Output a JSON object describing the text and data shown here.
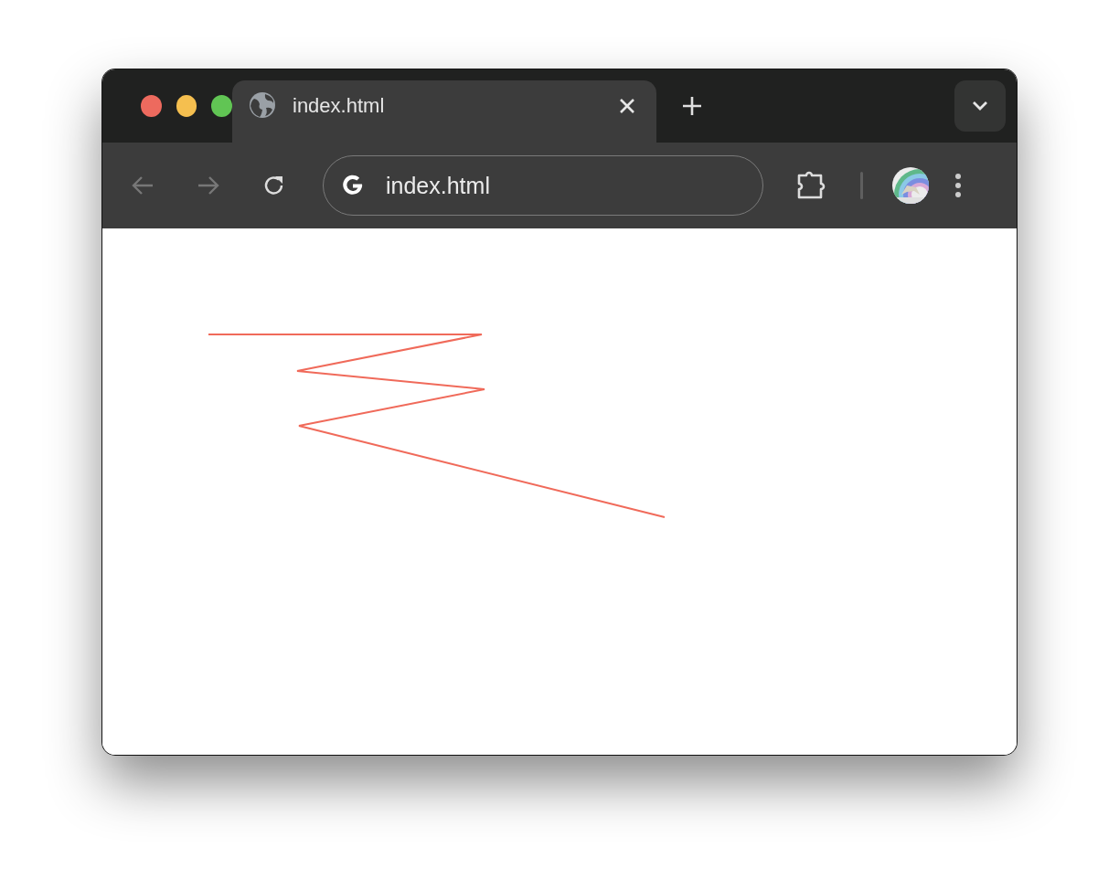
{
  "tab": {
    "title": "index.html",
    "selected": true
  },
  "navigation": {
    "back_disabled": true,
    "forward_disabled": true
  },
  "address_bar": {
    "value": "index.html"
  }
}
